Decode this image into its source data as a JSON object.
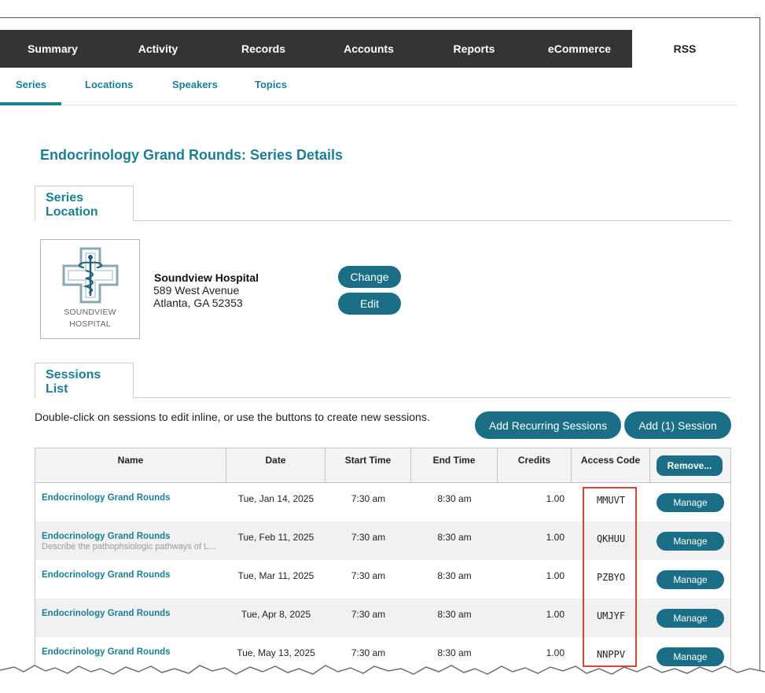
{
  "top_nav": {
    "tabs": [
      {
        "label": "Summary"
      },
      {
        "label": "Activity"
      },
      {
        "label": "Records"
      },
      {
        "label": "Accounts"
      },
      {
        "label": "Reports"
      },
      {
        "label": "eCommerce"
      },
      {
        "label": "RSS"
      }
    ],
    "active": "RSS"
  },
  "sub_nav": {
    "tabs": [
      {
        "label": "Series"
      },
      {
        "label": "Locations"
      },
      {
        "label": "Speakers"
      },
      {
        "label": "Topics"
      }
    ],
    "active": "Series"
  },
  "page_title": "Endocrinology Grand Rounds: Series Details",
  "series_location": {
    "tab_label_line1": "Series",
    "tab_label_line2": "Location",
    "logo_text_line1": "SOUNDVIEW",
    "logo_text_line2": "HOSPITAL",
    "name": "Soundview Hospital",
    "address_line1": "589 West Avenue",
    "address_line2": "Atlanta, GA 52353",
    "change_label": "Change",
    "edit_label": "Edit"
  },
  "sessions_list": {
    "tab_label_line1": "Sessions",
    "tab_label_line2": "List",
    "instruction": "Double-click on sessions to edit inline, or use the buttons to create new sessions.",
    "add_recurring_label": "Add Recurring Sessions",
    "add_session_label": "Add (1) Session",
    "columns": {
      "name": "Name",
      "date": "Date",
      "start": "Start Time",
      "end": "End Time",
      "credits": "Credits",
      "code": "Access Code"
    },
    "remove_label": "Remove...",
    "manage_label": "Manage",
    "rows": [
      {
        "name": "Endocrinology Grand Rounds",
        "desc": "",
        "date": "Tue, Jan 14, 2025",
        "start": "7:30 am",
        "end": "8:30 am",
        "credits": "1.00",
        "code": "MMUVT"
      },
      {
        "name": "Endocrinology Grand Rounds",
        "desc": "Describe the pathophsiologic pathways of L...",
        "date": "Tue, Feb 11, 2025",
        "start": "7:30 am",
        "end": "8:30 am",
        "credits": "1.00",
        "code": "QKHUU"
      },
      {
        "name": "Endocrinology Grand Rounds",
        "desc": "",
        "date": "Tue, Mar 11, 2025",
        "start": "7:30 am",
        "end": "8:30 am",
        "credits": "1.00",
        "code": "PZBYO"
      },
      {
        "name": "Endocrinology Grand Rounds",
        "desc": "",
        "date": "Tue, Apr 8, 2025",
        "start": "7:30 am",
        "end": "8:30 am",
        "credits": "1.00",
        "code": "UMJYF"
      },
      {
        "name": "Endocrinology Grand Rounds",
        "desc": "",
        "date": "Tue, May 13, 2025",
        "start": "7:30 am",
        "end": "8:30 am",
        "credits": "1.00",
        "code": "NNPPV"
      }
    ]
  },
  "colors": {
    "accent": "#1b7f94",
    "button": "#1a6f86",
    "nav_bg": "#343434",
    "highlight": "#e0413a"
  }
}
